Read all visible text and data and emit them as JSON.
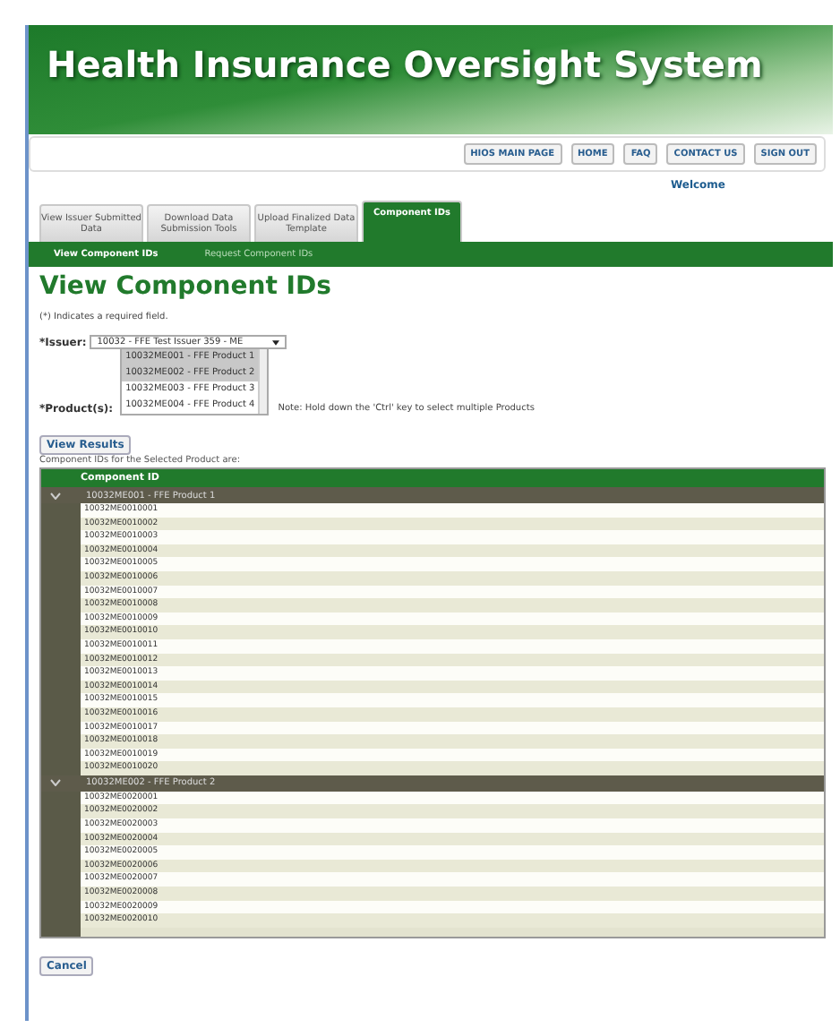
{
  "header": {
    "title": "Health Insurance Oversight System"
  },
  "nav_buttons": [
    "HIOS MAIN PAGE",
    "HOME",
    "FAQ",
    "CONTACT US",
    "SIGN OUT"
  ],
  "welcome": "Welcome",
  "tabs": [
    {
      "label": "View Issuer Submitted Data",
      "selected": false
    },
    {
      "label": "Download Data Submission Tools",
      "selected": false
    },
    {
      "label": "Upload Finalized Data Template",
      "selected": false
    },
    {
      "label": "Component IDs",
      "selected": true
    }
  ],
  "subtabs": [
    {
      "label": "View Component IDs",
      "selected": true
    },
    {
      "label": "Request Component IDs",
      "selected": false
    }
  ],
  "page_title": "View Component IDs",
  "required_note": "(*) Indicates a required field.",
  "issuer": {
    "label": "*Issuer:",
    "value": "10032 - FFE Test Issuer 359 - ME"
  },
  "products": {
    "label": "*Product(s):",
    "options": [
      {
        "label": "10032ME001 - FFE Product 1",
        "selected": true
      },
      {
        "label": "10032ME002 - FFE Product 2",
        "selected": true
      },
      {
        "label": "10032ME003 - FFE Product 3",
        "selected": false
      },
      {
        "label": "10032ME004 - FFE Product 4",
        "selected": false
      }
    ],
    "note": "Note: Hold down the 'Ctrl' key to select multiple Products"
  },
  "view_button": "View Results",
  "results_caption": "Component IDs for the Selected Product are:",
  "table": {
    "columns": [
      "Component ID"
    ],
    "groups": [
      {
        "name": "10032ME001 - FFE Product 1",
        "expanded": true,
        "rows": [
          "10032ME0010001",
          "10032ME0010002",
          "10032ME0010003",
          "10032ME0010004",
          "10032ME0010005",
          "10032ME0010006",
          "10032ME0010007",
          "10032ME0010008",
          "10032ME0010009",
          "10032ME0010010",
          "10032ME0010011",
          "10032ME0010012",
          "10032ME0010013",
          "10032ME0010014",
          "10032ME0010015",
          "10032ME0010016",
          "10032ME0010017",
          "10032ME0010018",
          "10032ME0010019",
          "10032ME0010020"
        ]
      },
      {
        "name": "10032ME002 - FFE Product 2",
        "expanded": true,
        "rows": [
          "10032ME0020001",
          "10032ME0020002",
          "10032ME0020003",
          "10032ME0020004",
          "10032ME0020005",
          "10032ME0020006",
          "10032ME0020007",
          "10032ME0020008",
          "10032ME0020009",
          "10032ME0020010"
        ]
      }
    ]
  },
  "cancel_button": "Cancel"
}
